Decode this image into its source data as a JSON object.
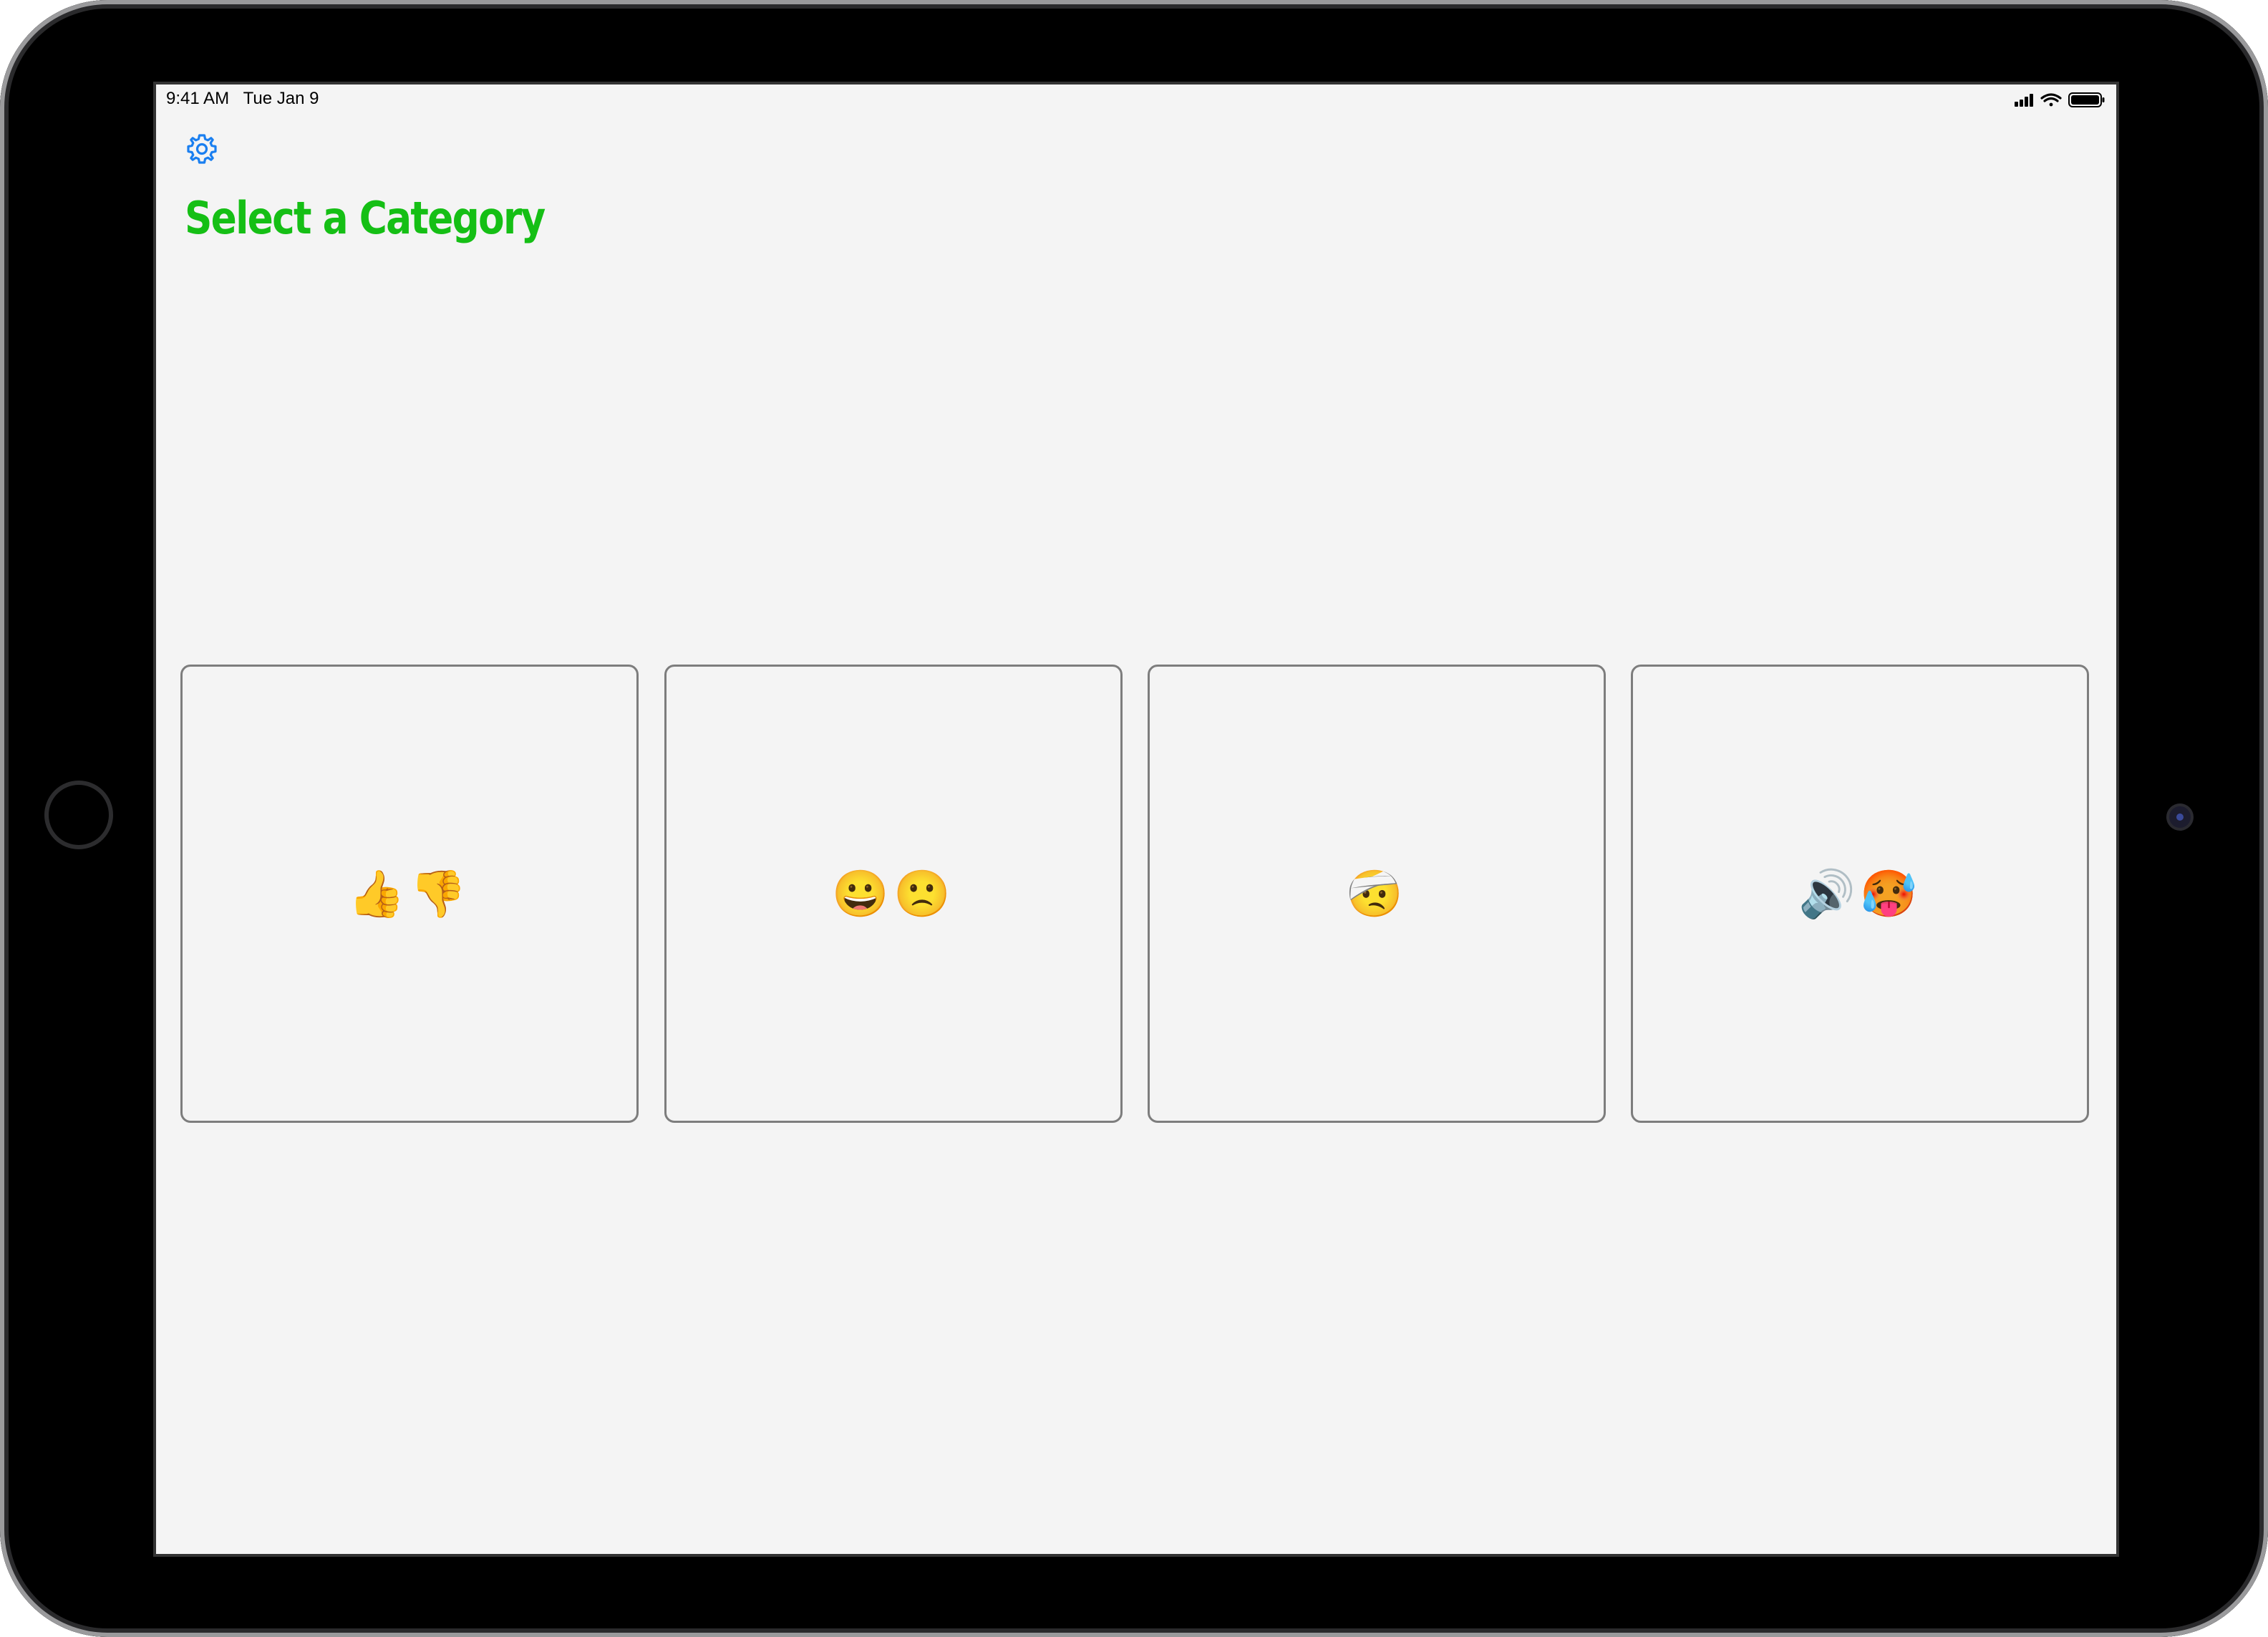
{
  "status_bar": {
    "time_date": "9:41 AM   Tue Jan 9",
    "icons": [
      "cellular-signal-icon",
      "wifi-icon",
      "battery-icon"
    ]
  },
  "toolbar": {
    "settings_icon": "gear-icon"
  },
  "page": {
    "title": "Select a Category"
  },
  "colors": {
    "title": "#15bf15",
    "accent": "#1a7ff0",
    "background": "#f4f4f4",
    "card_border": "#7d7d7d"
  },
  "categories": [
    {
      "emoji": "👍👎"
    },
    {
      "emoji": "😀🙁"
    },
    {
      "emoji": "🤕"
    },
    {
      "emoji": "🔊🥵"
    }
  ]
}
